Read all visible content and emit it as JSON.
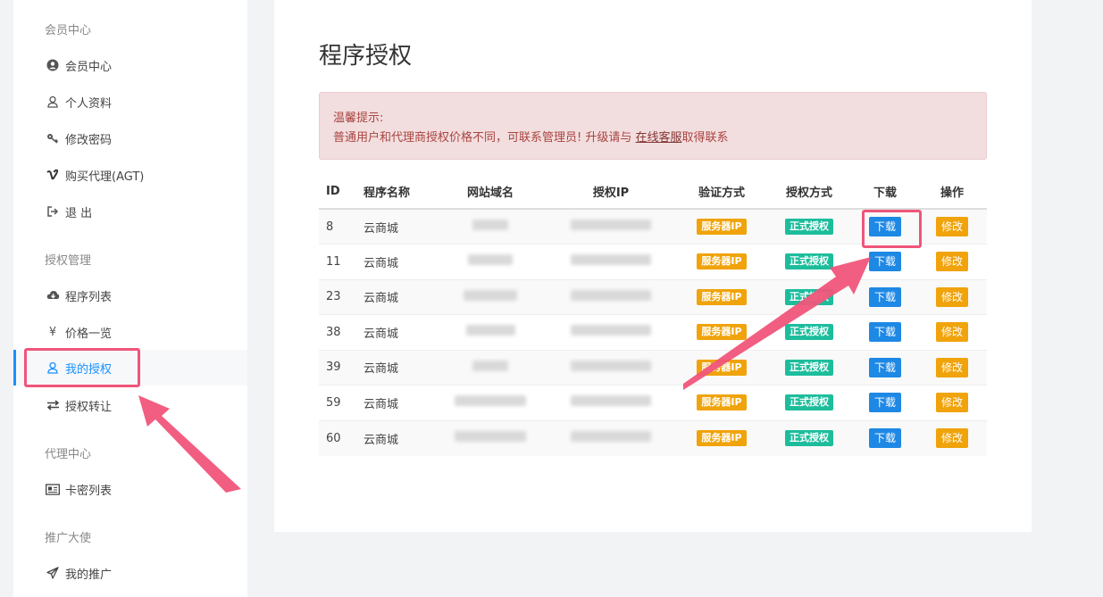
{
  "sidebar": {
    "sections": [
      {
        "title": "会员中心"
      },
      {
        "title": "授权管理"
      },
      {
        "title": "代理中心"
      },
      {
        "title": "推广大使"
      }
    ],
    "items": [
      {
        "label": "会员中心",
        "icon": "user-circle-icon"
      },
      {
        "label": "个人资料",
        "icon": "user-icon"
      },
      {
        "label": "修改密码",
        "icon": "key-icon"
      },
      {
        "label": "购买代理(AGT)",
        "icon": "vimeo-icon"
      },
      {
        "label": "退 出",
        "icon": "sign-out-icon"
      },
      {
        "label": "程序列表",
        "icon": "cloud-download-icon"
      },
      {
        "label": "价格一览",
        "icon": "yen-icon"
      },
      {
        "label": "我的授权",
        "icon": "user-icon",
        "active": true
      },
      {
        "label": "授权转让",
        "icon": "exchange-icon"
      },
      {
        "label": "卡密列表",
        "icon": "id-card-icon"
      },
      {
        "label": "我的推广",
        "icon": "send-icon"
      }
    ]
  },
  "main": {
    "title": "程序授权",
    "alert": {
      "line1": "温馨提示:",
      "line2_prefix": "普通用户和代理商授权价格不同，可联系管理员! 升级请与 ",
      "link": "在线客服",
      "line2_suffix": "取得联系"
    },
    "table": {
      "headers": [
        "ID",
        "程序名称",
        "网站域名",
        "授权IP",
        "验证方式",
        "授权方式",
        "下载",
        "操作"
      ],
      "rows": [
        {
          "id": "8",
          "name": "云商城",
          "verify": "服务器IP",
          "auth": "正式授权",
          "download": "下载",
          "action": "修改"
        },
        {
          "id": "11",
          "name": "云商城",
          "verify": "服务器IP",
          "auth": "正式授权",
          "download": "下载",
          "action": "修改"
        },
        {
          "id": "23",
          "name": "云商城",
          "verify": "服务器IP",
          "auth": "正式授权",
          "download": "下载",
          "action": "修改"
        },
        {
          "id": "38",
          "name": "云商城",
          "verify": "服务器IP",
          "auth": "正式授权",
          "download": "下载",
          "action": "修改"
        },
        {
          "id": "39",
          "name": "云商城",
          "verify": "服务器IP",
          "auth": "正式授权",
          "download": "下载",
          "action": "修改"
        },
        {
          "id": "59",
          "name": "云商城",
          "verify": "服务器IP",
          "auth": "正式授权",
          "download": "下载",
          "action": "修改"
        },
        {
          "id": "60",
          "name": "云商城",
          "verify": "服务器IP",
          "auth": "正式授权",
          "download": "下载",
          "action": "修改"
        }
      ]
    }
  },
  "colors": {
    "accent": "#1890ff",
    "highlight": "#f0557a",
    "label_orange": "#f0a30a",
    "label_green": "#1dbd9c",
    "button_blue": "#1e88e5"
  }
}
